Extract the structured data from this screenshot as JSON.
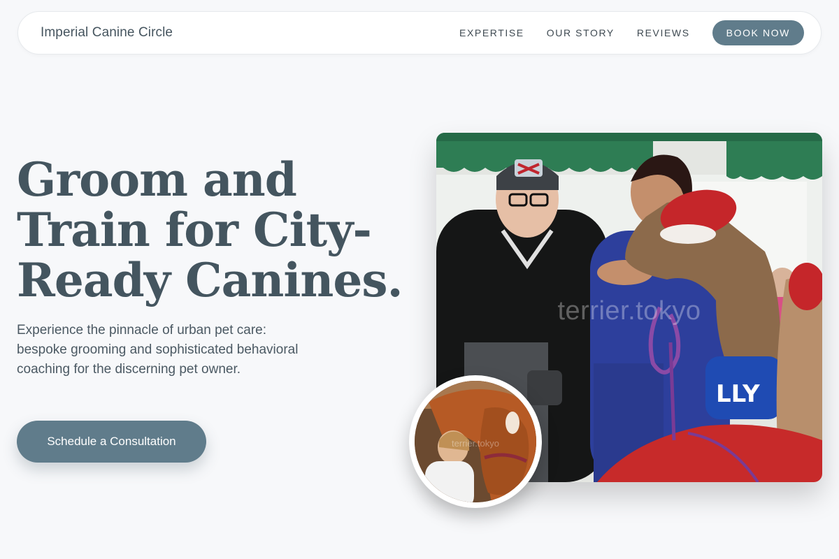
{
  "nav": {
    "brand": "Imperial Canine Circle",
    "links": [
      "EXPERTISE",
      "OUR STORY",
      "REVIEWS"
    ],
    "cta_label": "BOOK NOW"
  },
  "hero": {
    "headline": "Groom and Train for City-Ready Canines.",
    "subtext": "Experience the pinnacle of urban pet care: bespoke grooming and sophisticated behavioral coaching for the discerning pet owner.",
    "cta_label": "Schedule a Consultation"
  },
  "images": {
    "main_watermark": "terrier.tokyo",
    "circle_watermark": "terrier.tokyo"
  },
  "colors": {
    "accent": "#607c8b",
    "heading": "#44555f",
    "background": "#f7f8fa"
  }
}
